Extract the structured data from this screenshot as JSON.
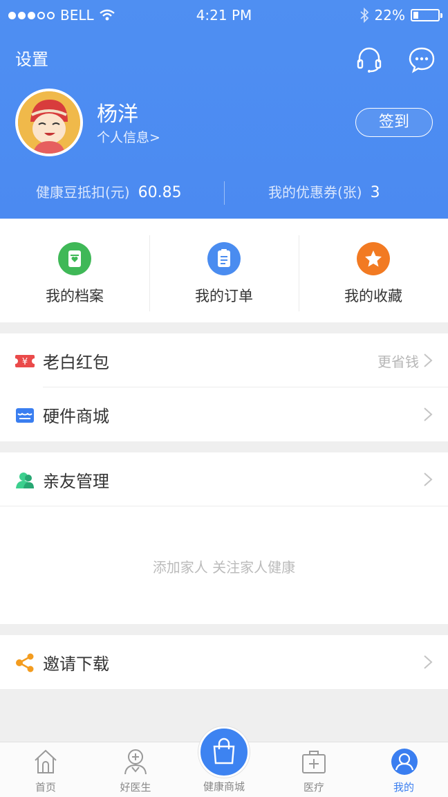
{
  "status": {
    "carrier": "BELL",
    "time": "4:21 PM",
    "battery": "22%",
    "battery_level": 0.22
  },
  "header": {
    "settings_label": "设置",
    "username": "杨洋",
    "profile_link": "个人信息>",
    "signin_label": "签到",
    "stat1_label": "健康豆抵扣(元)",
    "stat1_value": "60.85",
    "stat2_label": "我的优惠券(张)",
    "stat2_value": "3"
  },
  "quick": [
    {
      "label": "我的档案",
      "color": "#3fb857",
      "icon": "archive-icon"
    },
    {
      "label": "我的订单",
      "color": "#4a8cf0",
      "icon": "order-icon"
    },
    {
      "label": "我的收藏",
      "color": "#f27a22",
      "icon": "star-icon"
    }
  ],
  "menu": {
    "red_packet": {
      "label": "老白红包",
      "hint": "更省钱"
    },
    "hardware": {
      "label": "硬件商城"
    },
    "family": {
      "label": "亲友管理"
    },
    "family_empty": "添加家人   关注家人健康",
    "invite": {
      "label": "邀请下载"
    }
  },
  "tabs": [
    {
      "label": "首页",
      "icon": "home-icon"
    },
    {
      "label": "好医生",
      "icon": "doctor-icon"
    },
    {
      "label": "健康商城",
      "icon": "shopping-bag-icon"
    },
    {
      "label": "医疗",
      "icon": "medical-kit-icon"
    },
    {
      "label": "我的",
      "icon": "profile-icon"
    }
  ],
  "colors": {
    "primary": "#4b8af1",
    "accent": "#3a7ef0"
  }
}
